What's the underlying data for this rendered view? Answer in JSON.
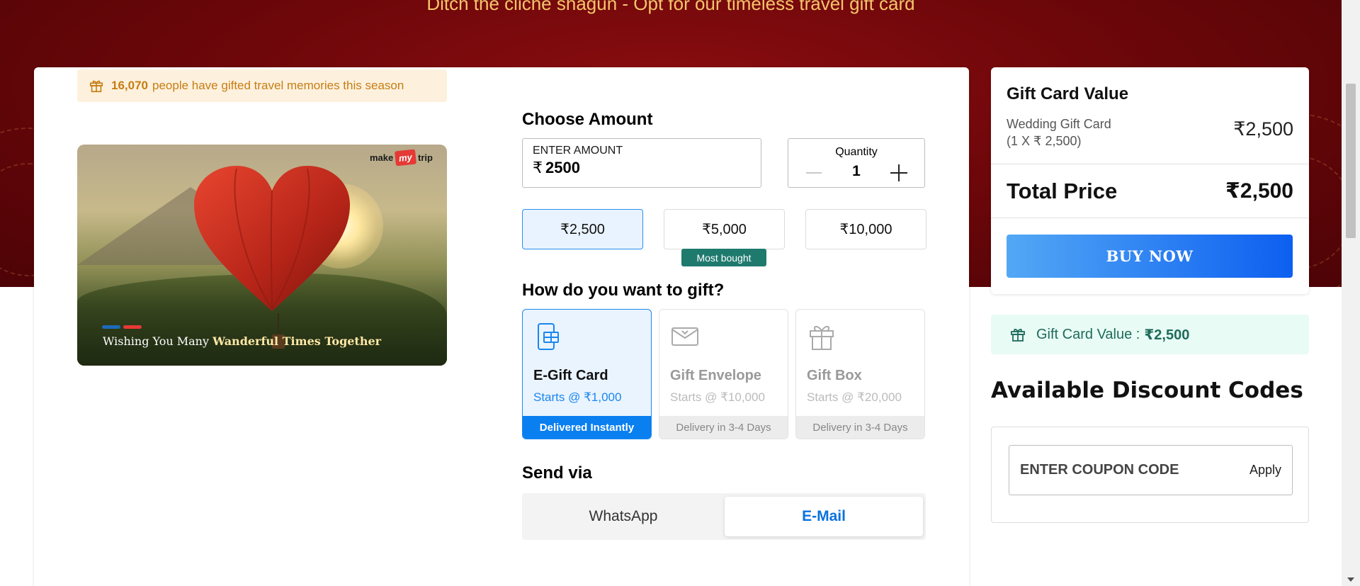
{
  "hero": {
    "title": "Ditch the cliche shagun - Opt for our timeless travel gift card"
  },
  "banner": {
    "count": "16,070",
    "text": "people have gifted travel memories this season"
  },
  "card_image": {
    "brand_pre": "make",
    "brand_my": "my",
    "brand_post": "trip",
    "tagline_plain": "Wishing You Many",
    "tagline_bold": "Wanderful Times Together"
  },
  "choose_amount": {
    "title": "Choose Amount",
    "input_label": "ENTER AMOUNT",
    "currency": "₹",
    "input_value": "2500",
    "quantity_label": "Quantity",
    "quantity_value": "1",
    "chips": [
      {
        "label": "₹2,500",
        "selected": true
      },
      {
        "label": "₹5,000",
        "selected": false
      },
      {
        "label": "₹10,000",
        "selected": false
      }
    ],
    "most_bought": "Most bought"
  },
  "gift_method": {
    "title": "How do you want to gift?",
    "options": [
      {
        "name": "E-Gift Card",
        "price": "Starts @ ₹1,000",
        "footer": "Delivered Instantly",
        "icon": "phone-gift-icon",
        "selected": true
      },
      {
        "name": "Gift Envelope",
        "price": "Starts @ ₹10,000",
        "footer": "Delivery in 3-4 Days",
        "icon": "envelope-icon",
        "selected": false
      },
      {
        "name": "Gift Box",
        "price": "Starts @ ₹20,000",
        "footer": "Delivery in 3-4 Days",
        "icon": "gift-box-icon",
        "selected": false
      }
    ]
  },
  "send_via": {
    "title": "Send via",
    "tabs": [
      {
        "label": "WhatsApp",
        "selected": false
      },
      {
        "label": "E-Mail",
        "selected": true
      }
    ]
  },
  "summary": {
    "title": "Gift Card Value",
    "item_name": "Wedding Gift Card",
    "item_detail": "(1 X ₹ 2,500)",
    "item_amount": "₹2,500",
    "total_label": "Total Price",
    "total_amount": "₹2,500",
    "buy_label": "BUY NOW"
  },
  "value_strip": {
    "label": "Gift Card Value :",
    "amount": "₹2,500"
  },
  "discounts": {
    "title": "Available Discount Codes",
    "coupon_placeholder": "ENTER COUPON CODE",
    "apply_label": "Apply"
  },
  "colors": {
    "accent": "#0a7ff0",
    "hero_bg": "#6e070a",
    "banner_text": "#c77d12",
    "teal": "#1f7a6e"
  }
}
